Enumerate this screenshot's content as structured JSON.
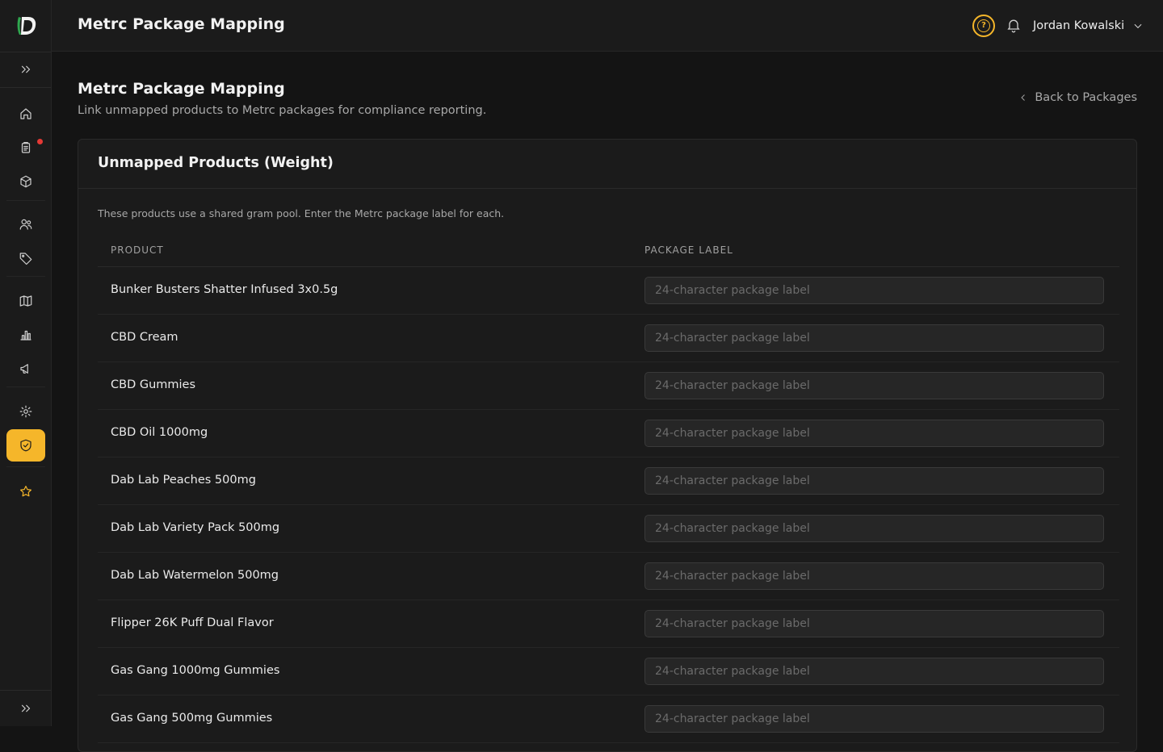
{
  "header": {
    "title": "Metrc Package Mapping",
    "user_name": "Jordan Kowalski",
    "help_glyph": "?"
  },
  "sidebar": {
    "items": [
      {
        "icon": "home-icon"
      },
      {
        "icon": "clipboard-icon",
        "has_notification": true
      },
      {
        "icon": "box-icon"
      },
      {
        "icon": "users-icon"
      },
      {
        "icon": "tag-icon"
      },
      {
        "icon": "map-icon"
      },
      {
        "icon": "bar-chart-icon"
      },
      {
        "icon": "megaphone-icon"
      },
      {
        "icon": "settings-icon"
      },
      {
        "icon": "shield-check-icon",
        "active": true
      },
      {
        "icon": "star-icon"
      }
    ],
    "accent_color": "#f5b62a"
  },
  "page": {
    "title": "Metrc Package Mapping",
    "subtitle": "Link unmapped products to Metrc packages for compliance reporting.",
    "back_link": "Back to Packages"
  },
  "card": {
    "title": "Unmapped Products (Weight)",
    "description": "These products use a shared gram pool. Enter the Metrc package label for each.",
    "columns": [
      "PRODUCT",
      "PACKAGE LABEL"
    ],
    "input_placeholder": "24-character package label",
    "rows": [
      {
        "product": "Bunker Busters Shatter Infused 3x0.5g",
        "package_label": ""
      },
      {
        "product": "CBD Cream",
        "package_label": ""
      },
      {
        "product": "CBD Gummies",
        "package_label": ""
      },
      {
        "product": "CBD Oil 1000mg",
        "package_label": ""
      },
      {
        "product": "Dab Lab Peaches 500mg",
        "package_label": ""
      },
      {
        "product": "Dab Lab Variety Pack 500mg",
        "package_label": ""
      },
      {
        "product": "Dab Lab Watermelon 500mg",
        "package_label": ""
      },
      {
        "product": "Flipper 26K Puff Dual Flavor",
        "package_label": ""
      },
      {
        "product": "Gas Gang 1000mg Gummies",
        "package_label": ""
      },
      {
        "product": "Gas Gang 500mg Gummies",
        "package_label": ""
      }
    ]
  }
}
